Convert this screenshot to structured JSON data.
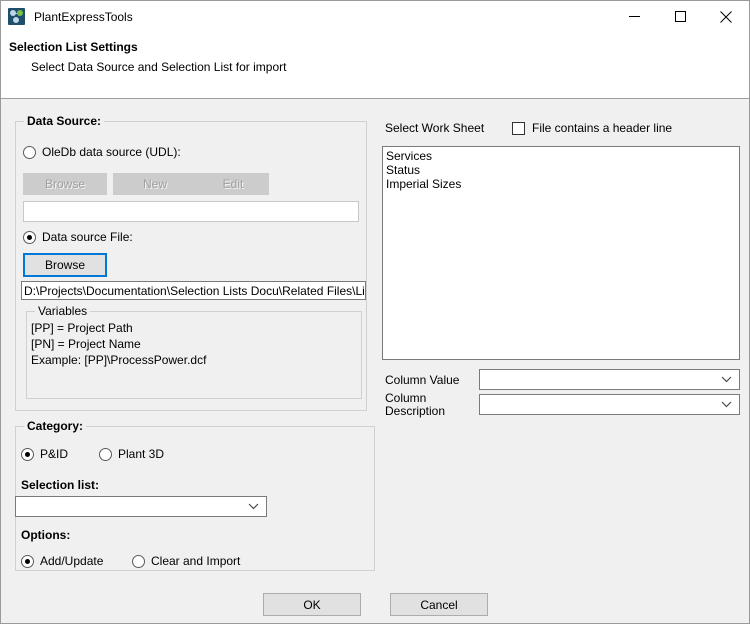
{
  "window": {
    "title": "PlantExpressTools",
    "icon": "app-icon",
    "controls": {
      "minimize": "minimize-icon",
      "maximize": "maximize-icon",
      "close": "close-icon"
    }
  },
  "header": {
    "title": "Selection List Settings",
    "subtitle": "Select Data Source and Selection List for import"
  },
  "data_source": {
    "legend": "Data Source:",
    "oledb_radio": {
      "label": "OleDb data source (UDL):",
      "checked": false
    },
    "oledb_buttons": [
      {
        "label": "Browse",
        "disabled": true
      },
      {
        "label": "New",
        "disabled": true
      },
      {
        "label": "Edit",
        "disabled": true
      }
    ],
    "oledb_path": {
      "value": "",
      "placeholder": ""
    },
    "file_radio": {
      "label": "Data source File:",
      "checked": true
    },
    "file_browse_button": {
      "label": "Browse",
      "focused": true
    },
    "file_path": {
      "value": "D:\\Projects\\Documentation\\Selection Lists Docu\\Related Files\\Lists f",
      "placeholder": ""
    },
    "variables": {
      "legend": "Variables",
      "lines": [
        "[PP] =   Project Path",
        "[PN] =   Project Name",
        "Example: [PP]\\ProcessPower.dcf"
      ]
    }
  },
  "category": {
    "legend": "Category:",
    "radios": [
      {
        "label": "P&ID",
        "checked": true
      },
      {
        "label": "Plant 3D",
        "checked": false
      }
    ],
    "selection_list_label": "Selection list:",
    "selection_list": {
      "value": "",
      "options": []
    },
    "options_label": "Options:",
    "option_radios": [
      {
        "label": "Add/Update",
        "checked": true
      },
      {
        "label": "Clear and Import",
        "checked": false
      }
    ]
  },
  "worksheet": {
    "label": "Select Work Sheet",
    "header_checkbox": {
      "label": "File contains a header line",
      "checked": false
    },
    "items": [
      "Services",
      "Status",
      "Imperial Sizes"
    ],
    "column_value_label": "Column Value",
    "column_value": {
      "value": "",
      "options": []
    },
    "column_description_label_line1": "Column",
    "column_description_label_line2": "Description",
    "column_description": {
      "value": "",
      "options": []
    }
  },
  "footer": {
    "ok_label": "OK",
    "cancel_label": "Cancel"
  },
  "colors": {
    "accent": "#0078d7",
    "dialog_background": "#f0f0f0",
    "field_background": "#ffffff",
    "button_face": "#e1e1e1",
    "disabled_face": "#cccccc"
  }
}
